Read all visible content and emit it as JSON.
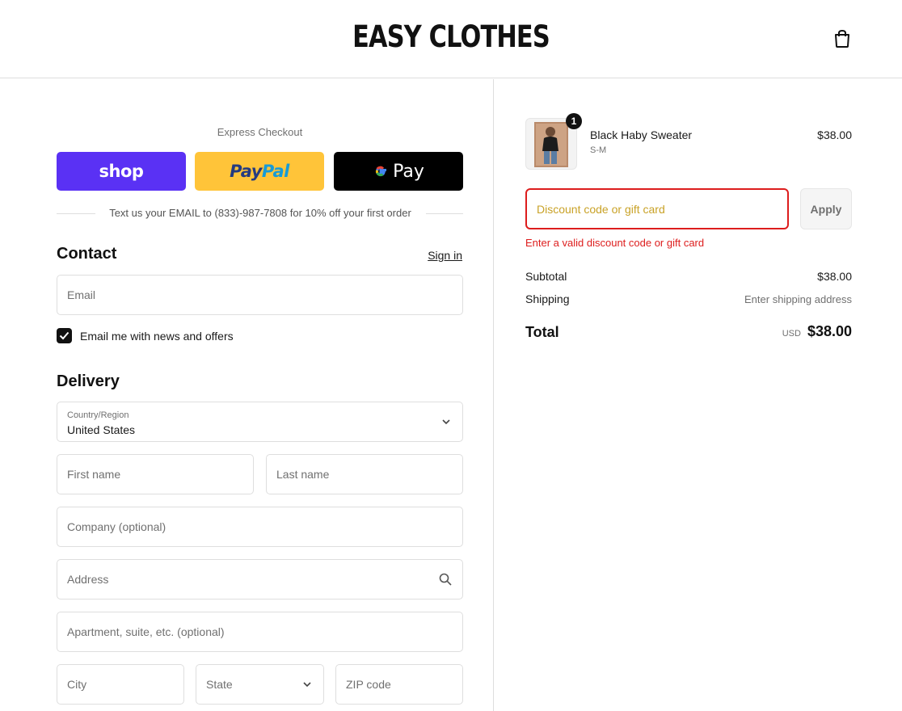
{
  "header": {
    "brand": "EASY CLOTHES",
    "cart_icon": "shopping-bag-icon"
  },
  "express": {
    "title": "Express Checkout",
    "shop_label": "shop",
    "paypal_part1": "Pay",
    "paypal_part2": "Pal",
    "gpay_label": "Pay",
    "shop_color": "#5a31f4",
    "paypal_color": "#ffc439",
    "gpay_color": "#000000"
  },
  "promo_text": "Text us your EMAIL to (833)-987-7808 for 10% off your first order",
  "contact": {
    "title": "Contact",
    "sign_in": "Sign in",
    "email_placeholder": "Email",
    "newsletter_label": "Email me with news and offers",
    "newsletter_checked": true
  },
  "delivery": {
    "title": "Delivery",
    "country_label": "Country/Region",
    "country_value": "United States",
    "first_name": "First name",
    "last_name": "Last name",
    "company": "Company (optional)",
    "address": "Address",
    "apartment": "Apartment, suite, etc. (optional)",
    "city": "City",
    "state": "State",
    "zip": "ZIP code"
  },
  "order": {
    "item": {
      "name": "Black Haby Sweater",
      "variant": "S-M",
      "price": "$38.00",
      "quantity": "1"
    },
    "discount_placeholder": "Discount code or gift card",
    "apply_label": "Apply",
    "error": "Enter a valid discount code or gift card",
    "subtotal_label": "Subtotal",
    "subtotal_value": "$38.00",
    "shipping_label": "Shipping",
    "shipping_value": "Enter shipping address",
    "total_label": "Total",
    "currency": "USD",
    "total_value": "$38.00",
    "error_color": "#dd1d1d"
  }
}
